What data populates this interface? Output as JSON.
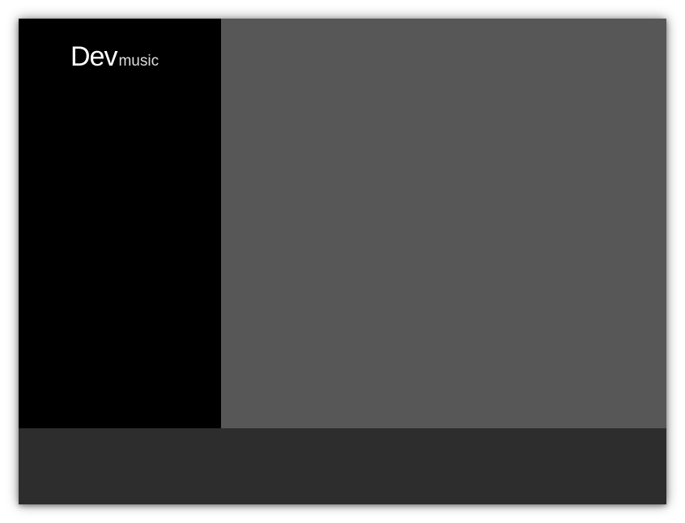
{
  "app": {
    "logo_main": "Dev",
    "logo_sub": "music"
  },
  "colors": {
    "sidebar_bg": "#000000",
    "main_bg": "#575757",
    "player_bar_bg": "#2d2d2d",
    "logo_text": "#ffffff"
  }
}
